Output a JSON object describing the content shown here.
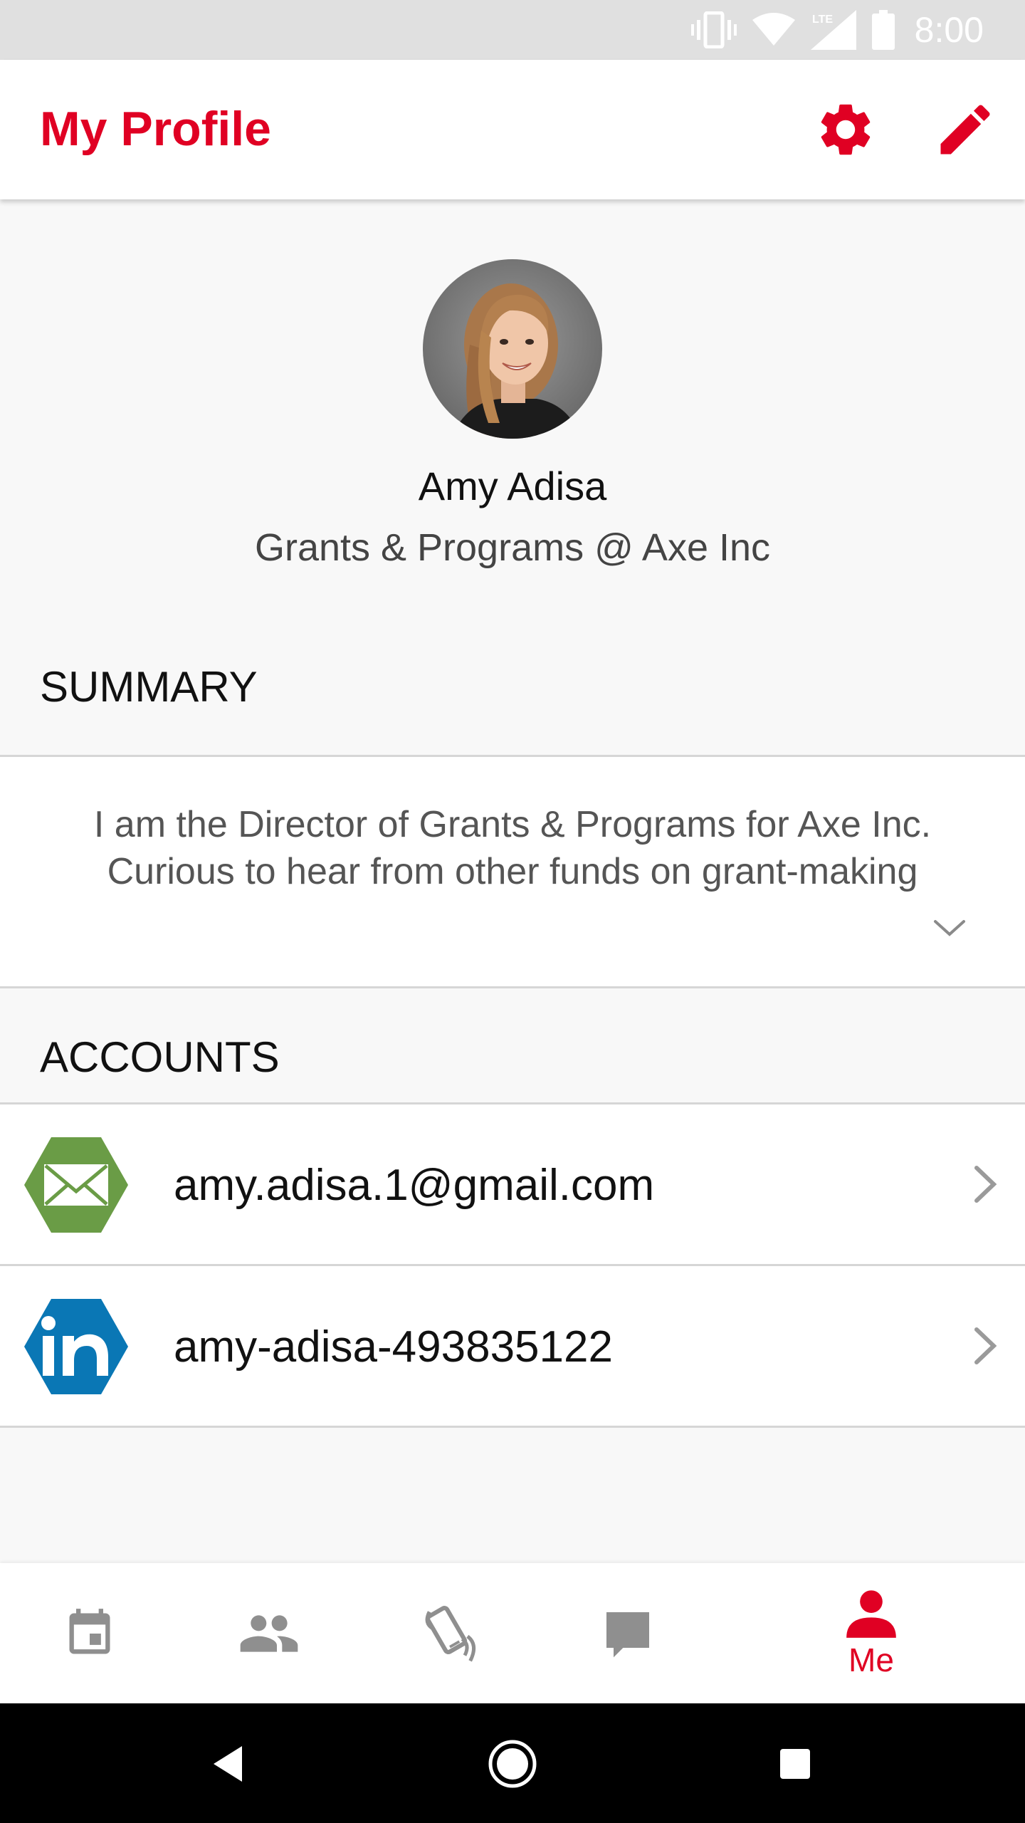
{
  "status_bar": {
    "time": "8:00",
    "icons": [
      "vibrate-icon",
      "wifi-icon",
      "lte-signal-icon",
      "battery-icon"
    ]
  },
  "app_bar": {
    "title": "My Profile",
    "actions": [
      "settings-icon",
      "edit-icon"
    ]
  },
  "profile": {
    "name": "Amy Adisa",
    "headline": "Grants & Programs @ Axe Inc"
  },
  "summary": {
    "header": "SUMMARY",
    "text": "I am the Director of Grants & Programs for Axe Inc. Curious to hear from other funds on grant-making"
  },
  "accounts": {
    "header": "ACCOUNTS",
    "items": [
      {
        "icon": "email-icon",
        "label": "amy.adisa.1@gmail.com"
      },
      {
        "icon": "linkedin-icon",
        "label": "amy-adisa-493835122"
      }
    ]
  },
  "bottom_nav": {
    "items": [
      {
        "icon": "calendar-icon",
        "label": ""
      },
      {
        "icon": "people-icon",
        "label": ""
      },
      {
        "icon": "phone-shake-icon",
        "label": ""
      },
      {
        "icon": "chat-icon",
        "label": ""
      },
      {
        "icon": "person-icon",
        "label": "Me",
        "active": true
      }
    ]
  },
  "colors": {
    "accent": "#e00023",
    "email_green": "#6a9c46",
    "linkedin_blue": "#0a77b5",
    "inactive_icon": "#8f8f8f"
  }
}
